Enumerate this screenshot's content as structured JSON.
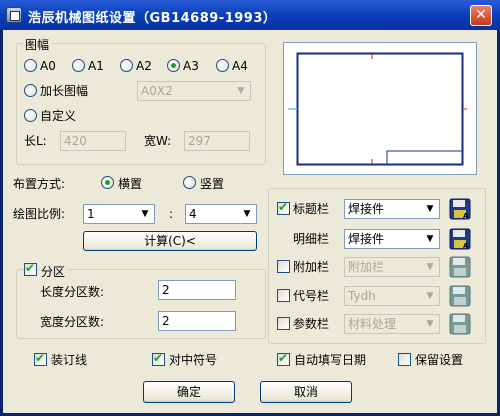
{
  "window": {
    "title": "浩辰机械图纸设置（GB14689-1993）",
    "close_label": "✕"
  },
  "paper_size": {
    "group_label": "图幅",
    "sizes": [
      "A0",
      "A1",
      "A2",
      "A3",
      "A4"
    ],
    "selected": "A3",
    "extended_label": "加长图幅",
    "extended_value": "A0X2",
    "custom_label": "自定义",
    "length_label": "长L:",
    "length_value": "420",
    "width_label": "宽W:",
    "width_value": "297"
  },
  "layout": {
    "label": "布置方式:",
    "landscape_label": "横置",
    "portrait_label": "竖置",
    "selected": "横置"
  },
  "scale": {
    "label": "绘图比例:",
    "left_value": "1",
    "separator": ":",
    "right_value": "4",
    "compute_label": "计算(C)<"
  },
  "zones": {
    "label": "分区",
    "checked": true,
    "length_zones_label": "长度分区数:",
    "length_zones_value": "2",
    "width_zones_label": "宽度分区数:",
    "width_zones_value": "2"
  },
  "blocks": [
    {
      "label": "标题栏",
      "checked": true,
      "has_checkbox": true,
      "value": "焊接件",
      "enabled": true
    },
    {
      "label": "明细栏",
      "checked": false,
      "has_checkbox": false,
      "value": "焊接件",
      "enabled": true
    },
    {
      "label": "附加栏",
      "checked": false,
      "has_checkbox": true,
      "value": "附加栏",
      "enabled": false
    },
    {
      "label": "代号栏",
      "checked": false,
      "has_checkbox": true,
      "value": "Tydh",
      "enabled": false
    },
    {
      "label": "参数栏",
      "checked": false,
      "has_checkbox": true,
      "value": "材料处理",
      "enabled": false
    }
  ],
  "options": {
    "binding_line_label": "装订线",
    "binding_line_checked": true,
    "center_mark_label": "对中符号",
    "center_mark_checked": true,
    "auto_date_label": "自动填写日期",
    "auto_date_checked": true,
    "keep_settings_label": "保留设置",
    "keep_settings_checked": false
  },
  "buttons": {
    "ok_label": "确定",
    "cancel_label": "取消"
  },
  "colors": {
    "title_bar": "#0a3fb8",
    "dialog_bg": "#ece9d8",
    "radio_dot": "#21a121",
    "preview_line": "#1a2a80",
    "preview_mark": "#cc2222"
  },
  "icons": {
    "save": "floppy-disk-icon",
    "close": "close-icon",
    "app": "app-icon"
  }
}
